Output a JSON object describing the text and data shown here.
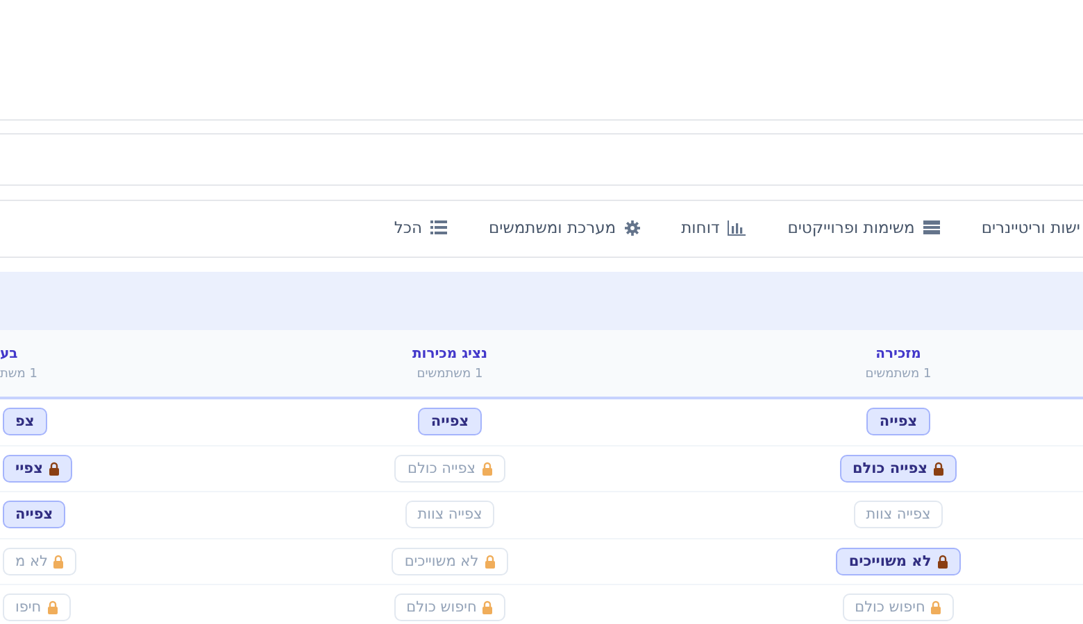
{
  "tabs": [
    {
      "label": "ישות וריטיינרים",
      "kind": "plain",
      "selected": false
    },
    {
      "label": "משימות ופרוייקטים",
      "kind": "table",
      "selected": false
    },
    {
      "label": "דוחות",
      "kind": "chart",
      "selected": false
    },
    {
      "label": "מערכת ומשתמשים",
      "kind": "gear",
      "selected": false
    },
    {
      "label": "הכל",
      "kind": "list",
      "selected": false
    }
  ],
  "table": {
    "columns": [
      {
        "title": "מזכירה",
        "subtitle": "1 משתמשים"
      },
      {
        "title": "נציג מכירות",
        "subtitle": "1 משתמשים"
      },
      {
        "title": "בע",
        "subtitle": "1 משת"
      }
    ],
    "rows": [
      [
        {
          "label": "צפייה",
          "active": true,
          "locked": false
        },
        {
          "label": "צפייה",
          "active": true,
          "locked": false
        },
        {
          "label": "צפ",
          "active": true,
          "locked": false
        }
      ],
      [
        {
          "label": "צפייה כולם",
          "active": true,
          "locked": true
        },
        {
          "label": "צפייה כולם",
          "active": false,
          "locked": true
        },
        {
          "label": "צפיי",
          "active": true,
          "locked": true
        }
      ],
      [
        {
          "label": "צפייה צוות",
          "active": false,
          "locked": false
        },
        {
          "label": "צפייה צוות",
          "active": false,
          "locked": false
        },
        {
          "label": "צפייה",
          "active": true,
          "locked": false
        }
      ],
      [
        {
          "label": "לא משוייכים",
          "active": true,
          "locked": true
        },
        {
          "label": "לא משוייכים",
          "active": false,
          "locked": true
        },
        {
          "label": "לא מ",
          "active": false,
          "locked": true
        }
      ],
      [
        {
          "label": "חיפוש כולם",
          "active": false,
          "locked": true
        },
        {
          "label": "חיפוש כולם",
          "active": false,
          "locked": true
        },
        {
          "label": "חיפו",
          "active": false,
          "locked": true
        }
      ]
    ]
  }
}
